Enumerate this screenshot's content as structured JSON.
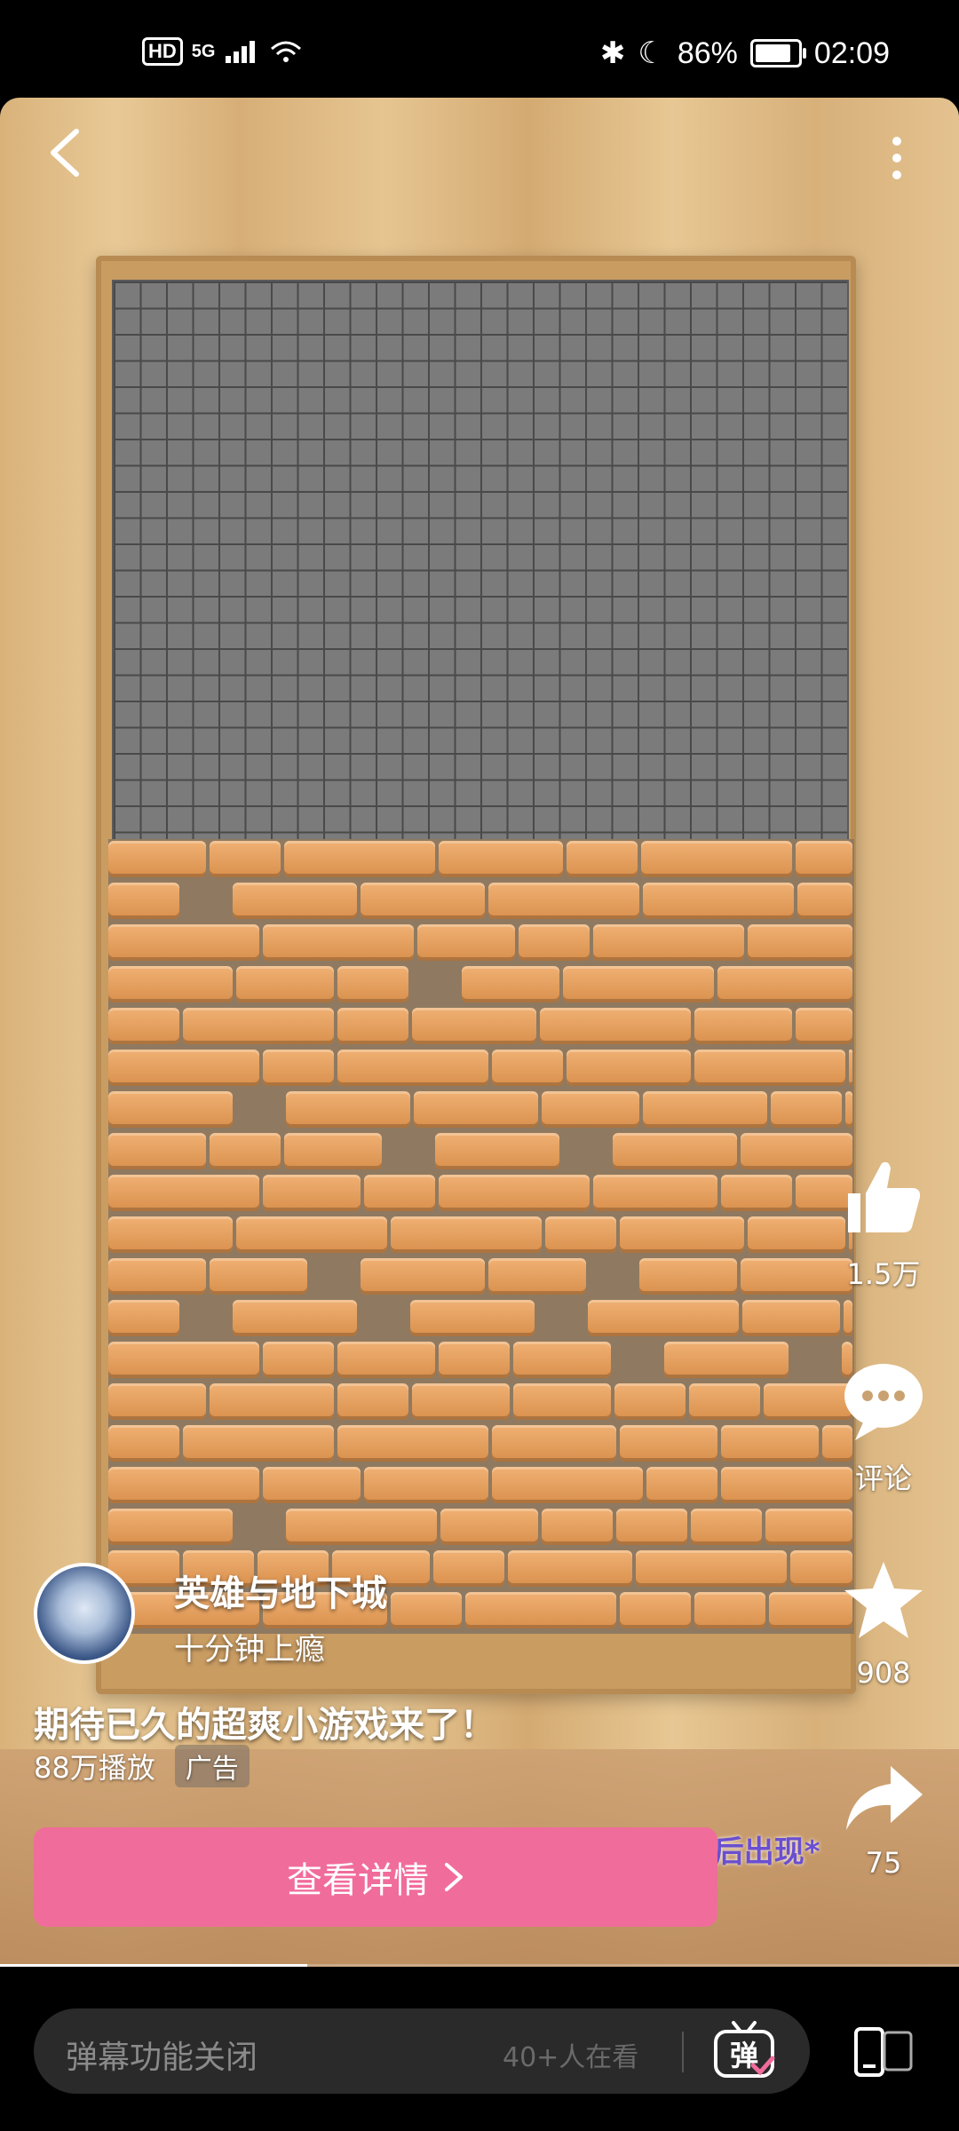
{
  "status_bar": {
    "left": {
      "hd": "HD",
      "net": "5G"
    },
    "battery_percent": "86%",
    "battery_level": 0.86,
    "time": "02:09"
  },
  "video": {
    "nav": {
      "back_icon": "chevron-left-icon",
      "more_icon": "more-vertical-icon"
    },
    "actions": {
      "like": {
        "icon": "thumbs-up-icon",
        "count": "1.5万"
      },
      "comment": {
        "icon": "comment-icon",
        "label": "评论"
      },
      "favorite": {
        "icon": "star-icon",
        "count": "908"
      },
      "share": {
        "icon": "share-icon",
        "count": "75"
      }
    },
    "author": {
      "name": "英雄与地下城",
      "slogan": "十分钟上瘾"
    },
    "caption": "期待已久的超爽小游戏来了！",
    "plays": "88万播放",
    "ad_tag": "广告",
    "disclaimer": "*广告素材宣传场景需达到一定关卡或触发相应模块后出现*",
    "cta_label": "查看详情",
    "progress": 0.32
  },
  "bottom_bar": {
    "danmaku_placeholder": "弹幕功能关闭",
    "viewers": "40+人在看",
    "danmaku_toggle_icon": "danmaku-toggle-icon",
    "danmaku_glyph": "弹",
    "orientation_icon": "screen-rotate-icon"
  },
  "colors": {
    "cta": "#f06c9b",
    "accent_text": "#6a4fd0"
  }
}
